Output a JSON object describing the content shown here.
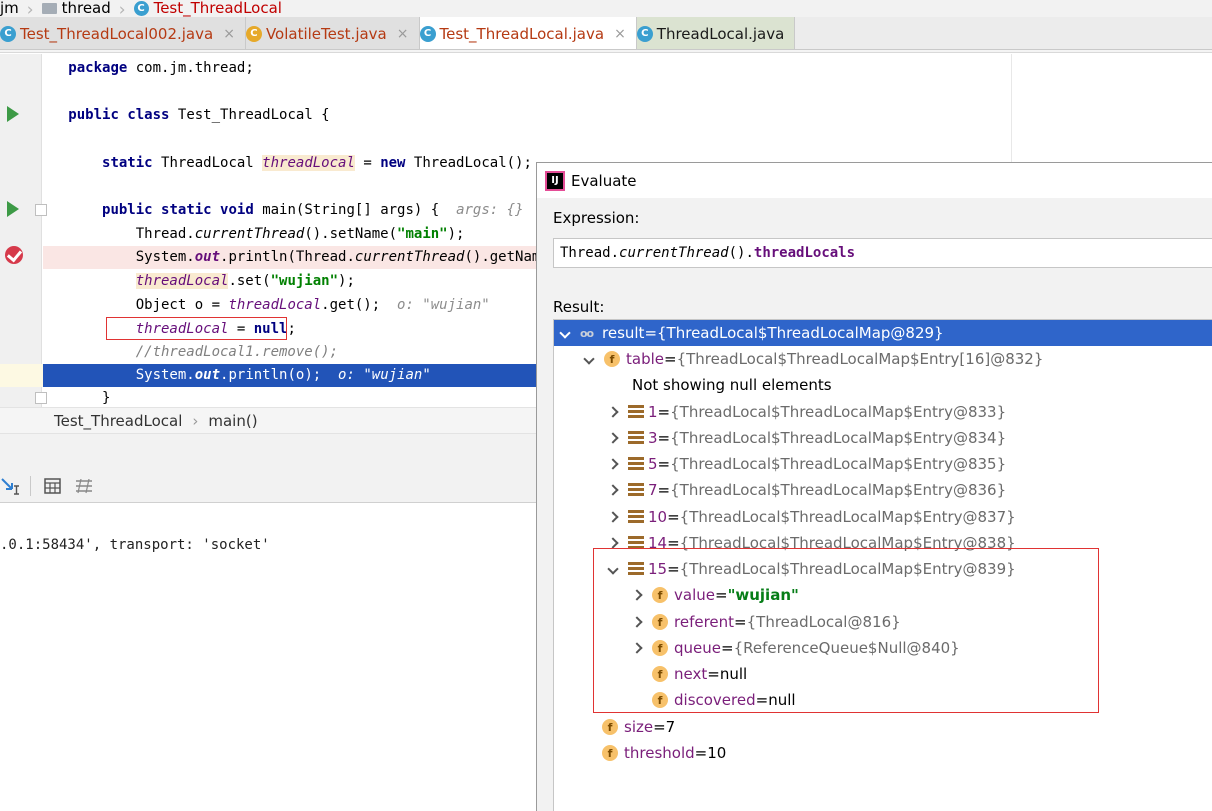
{
  "breadcrumb": {
    "items": [
      "jm",
      "thread",
      "Test_ThreadLocal"
    ]
  },
  "tabs": [
    {
      "label": "Test_ThreadLocal002.java",
      "close": "×"
    },
    {
      "label": "VolatileTest.java",
      "close": "×"
    },
    {
      "label": "Test_ThreadLocal.java",
      "close": "×"
    },
    {
      "label": "ThreadLocal.java",
      "close": ""
    }
  ],
  "code": {
    "l1_kw": "package",
    "l1_rest": " com.jm.thread;",
    "l2_kw1": "public",
    "l2_kw2": "class",
    "l2_rest": " Test_ThreadLocal {",
    "l3_kw": "static",
    "l3_type": " ThreadLocal ",
    "l3_field": "threadLocal",
    "l3_eq": " = ",
    "l3_new": "new",
    "l3_rest": " ThreadLocal();",
    "l4_kw1": "public",
    "l4_kw2": "static",
    "l4_kw3": "void",
    "l4_rest": " main(String[] args) {  ",
    "l4_hint": "args: {}",
    "l5_a": "Thread.",
    "l5_m": "currentThread",
    "l5_b": "().setName(",
    "l5_s": "\"main\"",
    "l5_c": ");",
    "l6_a": "System.",
    "l6_f": "out",
    "l6_b": ".println(Thread.",
    "l6_m": "currentThread",
    "l6_c": "().getName())",
    "l7_f": "threadLocal",
    "l7_a": ".set(",
    "l7_s": "\"wujian\"",
    "l7_b": ");",
    "l8_a": "Object o = ",
    "l8_f": "threadLocal",
    "l8_b": ".get();  ",
    "l8_hint": "o: \"wujian\"",
    "l9_f": "threadLocal",
    "l9_a": " = ",
    "l9_kw": "null",
    "l9_b": ";",
    "l10_cmt": "//threadLocal1.remove();",
    "l11_a": "System.",
    "l11_f": "out",
    "l11_b": ".println(o);  ",
    "l11_hint": "o: \"wujian\"",
    "l12": "}"
  },
  "navbar": {
    "class_crumb": "Test_ThreadLocal",
    "sep": "›",
    "method_crumb": "main()"
  },
  "console": {
    "line": ".0.1:58434', transport: 'socket'"
  },
  "evaluate": {
    "title": "Evaluate",
    "expression_label": "Expression:",
    "expr_a": "Thread.",
    "expr_m": "currentThread",
    "expr_b": "().",
    "expr_f": "threadLocals",
    "result_label": "Result:",
    "tree": [
      {
        "name": "result",
        "eq": " = ",
        "val": "{ThreadLocal$ThreadLocalMap@829}"
      },
      {
        "name": "table",
        "eq": " = ",
        "val": "{ThreadLocal$ThreadLocalMap$Entry[16]@832}"
      },
      {
        "text": "Not showing null elements"
      },
      {
        "name": "1",
        "eq": " = ",
        "val": "{ThreadLocal$ThreadLocalMap$Entry@833}"
      },
      {
        "name": "3",
        "eq": " = ",
        "val": "{ThreadLocal$ThreadLocalMap$Entry@834}"
      },
      {
        "name": "5",
        "eq": " = ",
        "val": "{ThreadLocal$ThreadLocalMap$Entry@835}"
      },
      {
        "name": "7",
        "eq": " = ",
        "val": "{ThreadLocal$ThreadLocalMap$Entry@836}"
      },
      {
        "name": "10",
        "eq": " = ",
        "val": "{ThreadLocal$ThreadLocalMap$Entry@837}"
      },
      {
        "name": "14",
        "eq": " = ",
        "val": "{ThreadLocal$ThreadLocalMap$Entry@838}"
      },
      {
        "name": "15",
        "eq": " = ",
        "val": "{ThreadLocal$ThreadLocalMap$Entry@839}"
      },
      {
        "name": "value",
        "eq": " = ",
        "val": "\"wujian\""
      },
      {
        "name": "referent",
        "eq": " = ",
        "val": "{ThreadLocal@816}"
      },
      {
        "name": "queue",
        "eq": " = ",
        "val": "{ReferenceQueue$Null@840}"
      },
      {
        "name": "next",
        "eq": " = ",
        "val": "null"
      },
      {
        "name": "discovered",
        "eq": " = ",
        "val": "null"
      },
      {
        "name": "size",
        "eq": " = ",
        "val": "7"
      },
      {
        "name": "threshold",
        "eq": " = ",
        "val": "10"
      }
    ]
  },
  "icons": {
    "class_letter": "C",
    "field_letter": "f",
    "object_glyph": "oo",
    "ij_glyph": "IJ"
  }
}
